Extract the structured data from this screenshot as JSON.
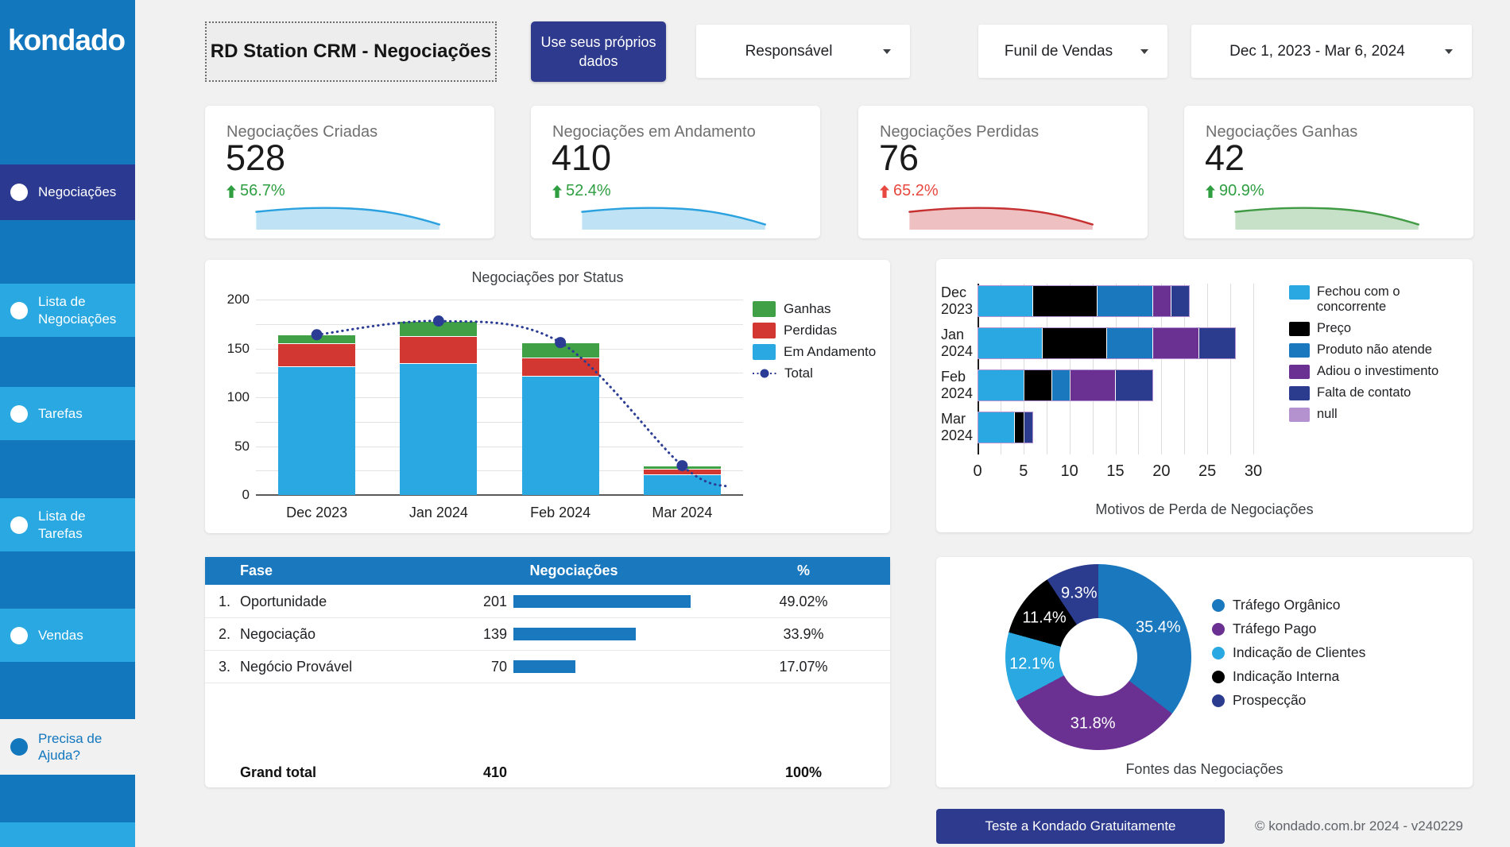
{
  "colors": {
    "sidebar_base": "#1377bd",
    "sidebar_item": "#29a8e1",
    "sidebar_active": "#2b3990",
    "navy_button": "#2d3a8d",
    "brand_blue": "#1a78be",
    "light_blue": "#29a8e1",
    "green": "#3fa045",
    "red": "#d23732",
    "purple": "#6a3192",
    "dark_navy": "#2b3c8f",
    "lavender": "#b492cf",
    "delta_green": "#2f9e41",
    "delta_red": "#e8483f"
  },
  "sidebar": {
    "logo": "kondado",
    "items": [
      {
        "id": "negociacoes",
        "label": "Negociações",
        "active": true
      },
      {
        "id": "lista-de-negociacoes",
        "label": "Lista de Negociações",
        "active": false
      },
      {
        "id": "tarefas",
        "label": "Tarefas",
        "active": false
      },
      {
        "id": "lista-de-tarefas",
        "label": "Lista de Tarefas",
        "active": false
      },
      {
        "id": "vendas",
        "label": "Vendas",
        "active": false
      }
    ],
    "help": {
      "id": "precisa-de-ajuda",
      "label": "Precisa de Ajuda?"
    }
  },
  "topbar": {
    "title": "RD Station CRM - Negociações",
    "cta": "Use seus próprios dados",
    "filters": [
      {
        "id": "responsavel",
        "label": "Responsável"
      },
      {
        "id": "funil-de-vendas",
        "label": "Funil de Vendas"
      }
    ],
    "date_range": "Dec 1, 2023 - Mar 6, 2024"
  },
  "kpis": [
    {
      "label": "Negociações Criadas",
      "value": "528",
      "delta": "56.7%",
      "direction": "up",
      "delta_color": "#2f9e41",
      "spark_color": "#2ba2df"
    },
    {
      "label": "Negociações em Andamento",
      "value": "410",
      "delta": "52.4%",
      "direction": "up",
      "delta_color": "#2f9e41",
      "spark_color": "#2ba2df"
    },
    {
      "label": "Negociações Perdidas",
      "value": "76",
      "delta": "65.2%",
      "direction": "up",
      "delta_color": "#e8483f",
      "spark_color": "#c63031"
    },
    {
      "label": "Negociações Ganhas",
      "value": "42",
      "delta": "90.9%",
      "direction": "up",
      "delta_color": "#2f9e41",
      "spark_color": "#419b45"
    }
  ],
  "sparkline_shape": [
    [
      1,
      10
    ],
    [
      20,
      5.5
    ],
    [
      34,
      4.5
    ],
    [
      50,
      6
    ],
    [
      66,
      7.5
    ],
    [
      80,
      13
    ],
    [
      97,
      25
    ]
  ],
  "chart_data": [
    {
      "type": "bar",
      "stacked": true,
      "title": "Negociações por Status",
      "categories": [
        "Dec 2023",
        "Jan 2024",
        "Feb 2024",
        "Mar 2024"
      ],
      "series": [
        {
          "name": "Em Andamento",
          "color": "#29a8e1",
          "values": [
            132,
            135,
            122,
            21
          ]
        },
        {
          "name": "Perdidas",
          "color": "#d23732",
          "values": [
            23,
            28,
            19,
            6
          ]
        },
        {
          "name": "Ganhas",
          "color": "#3fa045",
          "values": [
            9,
            15,
            15,
            3
          ]
        }
      ],
      "line_series": {
        "name": "Total",
        "color": "#2b3c94",
        "values": [
          164,
          178,
          156,
          30
        ]
      },
      "ylim": [
        0,
        200
      ],
      "yticks": [
        0,
        50,
        100,
        150,
        200
      ],
      "legend_order": [
        "Ganhas",
        "Perdidas",
        "Em Andamento",
        "Total"
      ],
      "legend_position": "right",
      "grid": true
    },
    {
      "type": "bar",
      "orientation": "horizontal",
      "stacked": true,
      "title": "Motivos de Perda de Negociações",
      "categories": [
        "Dec 2023",
        "Jan 2024",
        "Feb 2024",
        "Mar 2024"
      ],
      "series": [
        {
          "name": "Fechou com o concorrente",
          "color": "#29a8e1",
          "values": [
            6,
            7,
            5,
            4
          ]
        },
        {
          "name": "Preço",
          "color": "#000000",
          "values": [
            7,
            7,
            3,
            1
          ]
        },
        {
          "name": "Produto não atende",
          "color": "#1a78be",
          "values": [
            6,
            5,
            2,
            0
          ]
        },
        {
          "name": "Adiou o investimento",
          "color": "#6a3192",
          "values": [
            2,
            5,
            5,
            0
          ]
        },
        {
          "name": "Falta de contato",
          "color": "#2b3c8f",
          "values": [
            2,
            4,
            4,
            1
          ]
        },
        {
          "name": "null",
          "color": "#b492cf",
          "values": [
            0,
            0,
            0,
            0
          ]
        }
      ],
      "xlim": [
        0,
        30
      ],
      "xticks": [
        0,
        5,
        10,
        15,
        20,
        25,
        30
      ],
      "legend_position": "right",
      "grid": true
    },
    {
      "type": "table",
      "columns": [
        "Fase",
        "Negociações",
        "%"
      ],
      "rows": [
        {
          "index": "1.",
          "fase": "Oportunidade",
          "negociacoes": 201,
          "pct": "49.02%"
        },
        {
          "index": "2.",
          "fase": "Negociação",
          "negociacoes": 139,
          "pct": "33.9%"
        },
        {
          "index": "3.",
          "fase": "Negócio Provável",
          "negociacoes": 70,
          "pct": "17.07%"
        }
      ],
      "grand_total": {
        "label": "Grand total",
        "negociacoes": 410,
        "pct": "100%"
      },
      "bar_color": "#1a78be",
      "bar_max": 201
    },
    {
      "type": "pie",
      "donut": true,
      "title": "Fontes das Negociações",
      "labels": [
        "Tráfego Orgânico",
        "Tráfego Pago",
        "Indicação de Clientes",
        "Indicação Interna",
        "Prospecção"
      ],
      "values": [
        35.4,
        31.8,
        12.1,
        11.4,
        9.3
      ],
      "display_values": [
        "35.4%",
        "31.8%",
        "12.1%",
        "11.4%",
        "9.3%"
      ],
      "colors": [
        "#1a78be",
        "#6a3192",
        "#29a8e1",
        "#000000",
        "#2b3c8f"
      ],
      "legend_position": "right"
    }
  ],
  "footer": {
    "cta": "Teste a Kondado Gratuitamente",
    "copyright": "© kondado.com.br 2024 - v240229"
  }
}
